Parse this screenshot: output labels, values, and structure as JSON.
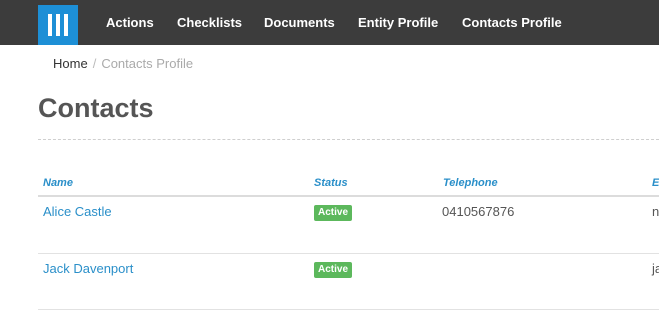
{
  "nav": {
    "items": [
      "Actions",
      "Checklists",
      "Documents",
      "Entity Profile",
      "Contacts Profile"
    ]
  },
  "breadcrumb": {
    "home": "Home",
    "separator": "/",
    "current": "Contacts Profile"
  },
  "page": {
    "title": "Contacts"
  },
  "table": {
    "headers": [
      "Name",
      "Status",
      "Telephone",
      "E"
    ],
    "rows": [
      {
        "name": "Alice Castle",
        "status": "Active",
        "telephone": "0410567876",
        "email": "n"
      },
      {
        "name": "Jack Davenport",
        "status": "Active",
        "telephone": "",
        "email": "ja"
      }
    ]
  },
  "colors": {
    "navbar": "#3c3c3c",
    "logo": "#1d8fd6",
    "link": "#2a8fc9",
    "status_active": "#5cb85c"
  },
  "icons": {
    "logo": "app-logo-icon"
  }
}
